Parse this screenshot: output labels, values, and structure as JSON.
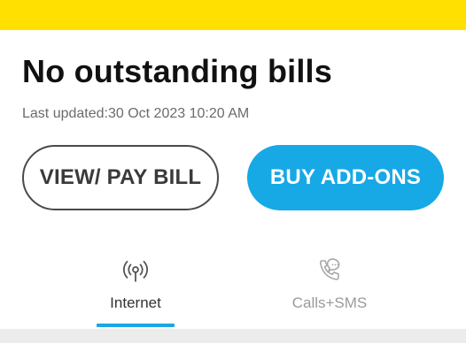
{
  "header": {
    "accent_color": "#ffe000"
  },
  "billing": {
    "title": "No outstanding bills",
    "last_updated": "Last updated:30 Oct 2023 10:20 AM"
  },
  "actions": {
    "view_pay_label": "VIEW/ PAY BILL",
    "buy_addons_label": "BUY ADD-ONS",
    "primary_color": "#17a8e6"
  },
  "tabs": [
    {
      "label": "Internet",
      "icon": "wifi-signal-icon",
      "active": true
    },
    {
      "label": "Calls+SMS",
      "icon": "phone-chat-icon",
      "active": false
    }
  ]
}
